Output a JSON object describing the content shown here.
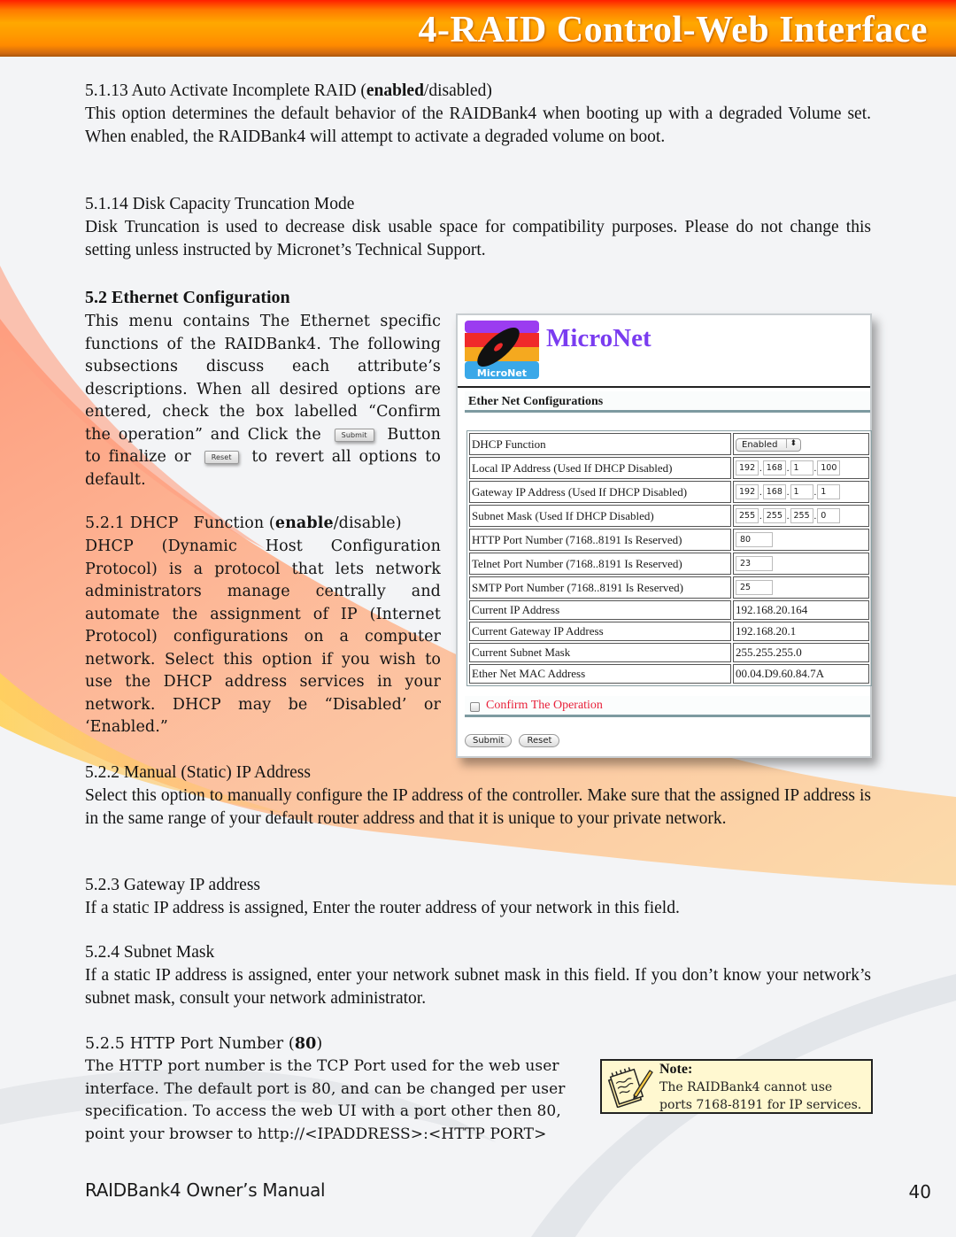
{
  "header": {
    "title": "4-RAID Control-Web Interface"
  },
  "sections": {
    "s5113": {
      "heading_prefix": "5.1.13 Auto Activate Incomplete RAID (",
      "heading_bold": "enabled",
      "heading_suffix": "/disabled)",
      "body": "This option determines the default behavior of the RAIDBank4 when booting up with a degraded Volume set. When enabled, the RAIDBank4 will attempt to activate a degraded volume on boot."
    },
    "s5114": {
      "heading": "5.1.14 Disk Capacity Truncation Mode",
      "body": "Disk Truncation is used to decrease disk usable space for compatibility purposes. Please do not change this setting unless instructed by Micronet’s Technical Support."
    },
    "s52": {
      "heading": "5.2 Ethernet Configuration",
      "body_part1": "This menu contains The Ethernet specific functions of the RAIDBank4. The following subsections discuss each attribute’s descriptions. When all desired options are entered, check the box labelled “Confirm the operation” and Click the",
      "inline_submit": "Submit",
      "body_part2": "Button to finalize or",
      "inline_reset": "Reset",
      "body_part3": "to revert all options to default."
    },
    "s521": {
      "heading_prefix": "5.2.1 DHCP   Function (",
      "heading_bold": "enable",
      "heading_suffix": "/disable)",
      "body": "DHCP (Dynamic Host Configuration Protocol) is a protocol that lets network administrators manage centrally and automate the assignment of IP (Internet Protocol) configurations on a computer network. Select this option if you wish to use the DHCP address services in your network. DHCP may be “Disabled’ or ‘Enabled.”"
    },
    "s522": {
      "heading": "5.2.2 Manual (Static) IP Address",
      "body": "Select this option to manually configure the IP address of the controller. Make sure that the assigned IP address is in the same range of your default router address and that it is unique to your private network."
    },
    "s523": {
      "heading": "5.2.3 Gateway IP address",
      "body": "If a static IP address is assigned, Enter the router address of your network in this field."
    },
    "s524": {
      "heading": "5.2.4 Subnet Mask",
      "body": "If a static IP address is assigned, enter your network subnet mask in this field. If you don’t know your network’s subnet mask, consult your network administrator."
    },
    "s525": {
      "heading_prefix": "5.2.5 HTTP Port Number (",
      "heading_bold": "80",
      "heading_suffix": ")",
      "body": "The HTTP port number is the TCP Port used for the web user interface. The default port is 80, and can be changed per user specification. To access the web UI with a port other then 80, point your browser to http://<IPADDRESS>:<HTTP PORT>"
    }
  },
  "panel": {
    "brand": "MicroNet",
    "logo_text": "MicroNet",
    "section_title": "Ether Net Configurations",
    "rows": {
      "dhcp": {
        "label": "DHCP Function",
        "value": "Enabled"
      },
      "local_ip": {
        "label": "Local IP Address (Used If DHCP Disabled)",
        "octets": [
          "192",
          "168",
          "1",
          "100"
        ]
      },
      "gateway_ip": {
        "label": "Gateway IP Address (Used If DHCP Disabled)",
        "octets": [
          "192",
          "168",
          "1",
          "1"
        ]
      },
      "subnet": {
        "label": "Subnet Mask (Used If DHCP Disabled)",
        "octets": [
          "255",
          "255",
          "255",
          "0"
        ]
      },
      "http_port": {
        "label": "HTTP Port Number (7168..8191 Is Reserved)",
        "value": "80"
      },
      "telnet_port": {
        "label": "Telnet Port Number (7168..8191 Is Reserved)",
        "value": "23"
      },
      "smtp_port": {
        "label": "SMTP Port Number (7168..8191 Is Reserved)",
        "value": "25"
      },
      "current_ip": {
        "label": "Current IP Address",
        "value": "192.168.20.164"
      },
      "current_gateway": {
        "label": "Current Gateway IP Address",
        "value": "192.168.20.1"
      },
      "current_subnet": {
        "label": "Current Subnet Mask",
        "value": "255.255.255.0"
      },
      "mac": {
        "label": "Ether Net MAC Address",
        "value": "00.04.D9.60.84.7A"
      }
    },
    "confirm_label": "Confirm The Operation",
    "confirm_checked": false,
    "submit_label": "Submit",
    "reset_label": "Reset"
  },
  "note": {
    "title": "Note:",
    "line1": "The RAIDBank4 cannot use",
    "line2": "ports 7168-8191 for IP services."
  },
  "footer": {
    "title": "RAIDBank4 Owner’s Manual",
    "page": "40"
  },
  "colors": {
    "header_orange": "#ffa800",
    "header_red": "#ff1e00",
    "brand_purple": "#7a3cf0",
    "confirm_red": "#e8213a",
    "note_bg": "#fff8d0"
  }
}
